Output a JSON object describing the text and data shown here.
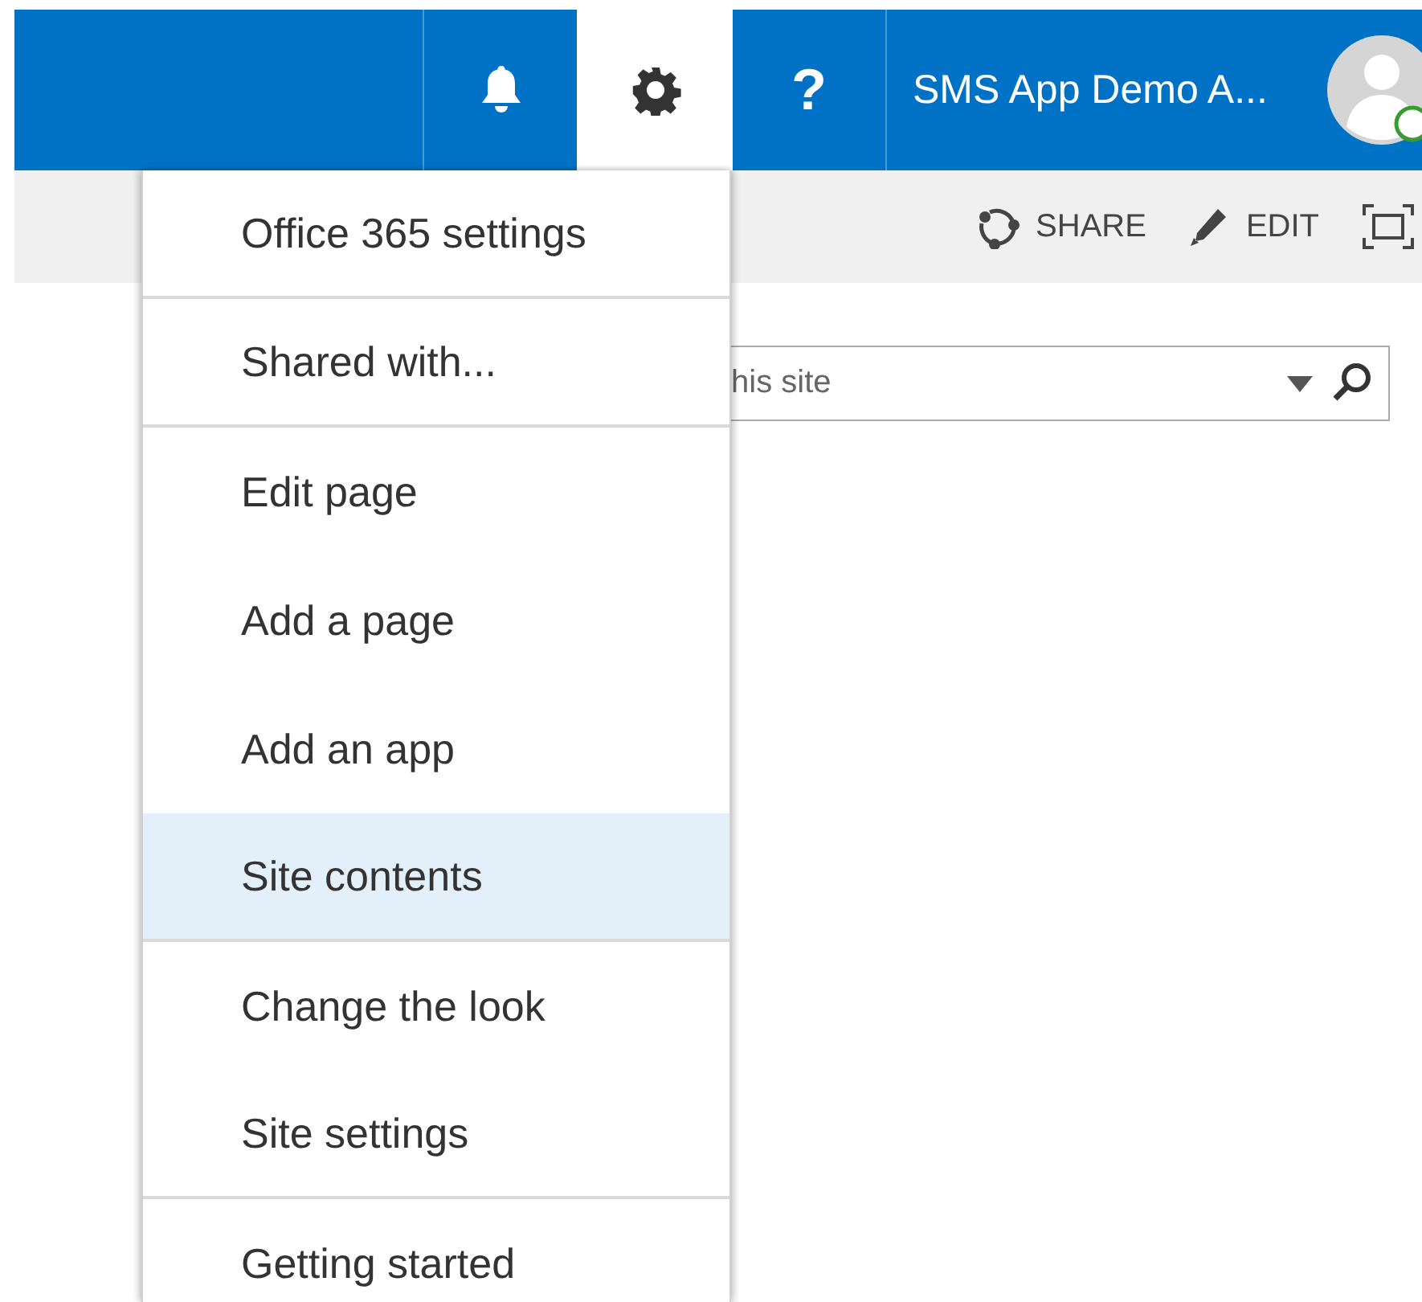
{
  "header": {
    "tiles": [
      {
        "kind": "bell",
        "selected": false
      },
      {
        "kind": "gear",
        "selected": true
      },
      {
        "kind": "help",
        "label": "?",
        "selected": false
      }
    ],
    "user_name": "SMS App Demo A..."
  },
  "command_bar": [
    {
      "kind": "share",
      "label": "SHARE"
    },
    {
      "kind": "edit",
      "label": "EDIT"
    },
    {
      "kind": "focus"
    }
  ],
  "search": {
    "placeholder": "his site"
  },
  "settings_menu": [
    {
      "label": "Office 365 settings",
      "selected": false,
      "divider_after": true
    },
    {
      "label": "Shared with...",
      "selected": false,
      "divider_after": true
    },
    {
      "label": "Edit page",
      "selected": false,
      "divider_after": false
    },
    {
      "label": "Add a page",
      "selected": false,
      "divider_after": false
    },
    {
      "label": "Add an app",
      "selected": false,
      "divider_after": false
    },
    {
      "label": "Site contents",
      "selected": true,
      "divider_after": true
    },
    {
      "label": "Change the look",
      "selected": false,
      "divider_after": false
    },
    {
      "label": "Site settings",
      "selected": false,
      "divider_after": true
    },
    {
      "label": "Getting started",
      "selected": false,
      "divider_after": false
    }
  ]
}
